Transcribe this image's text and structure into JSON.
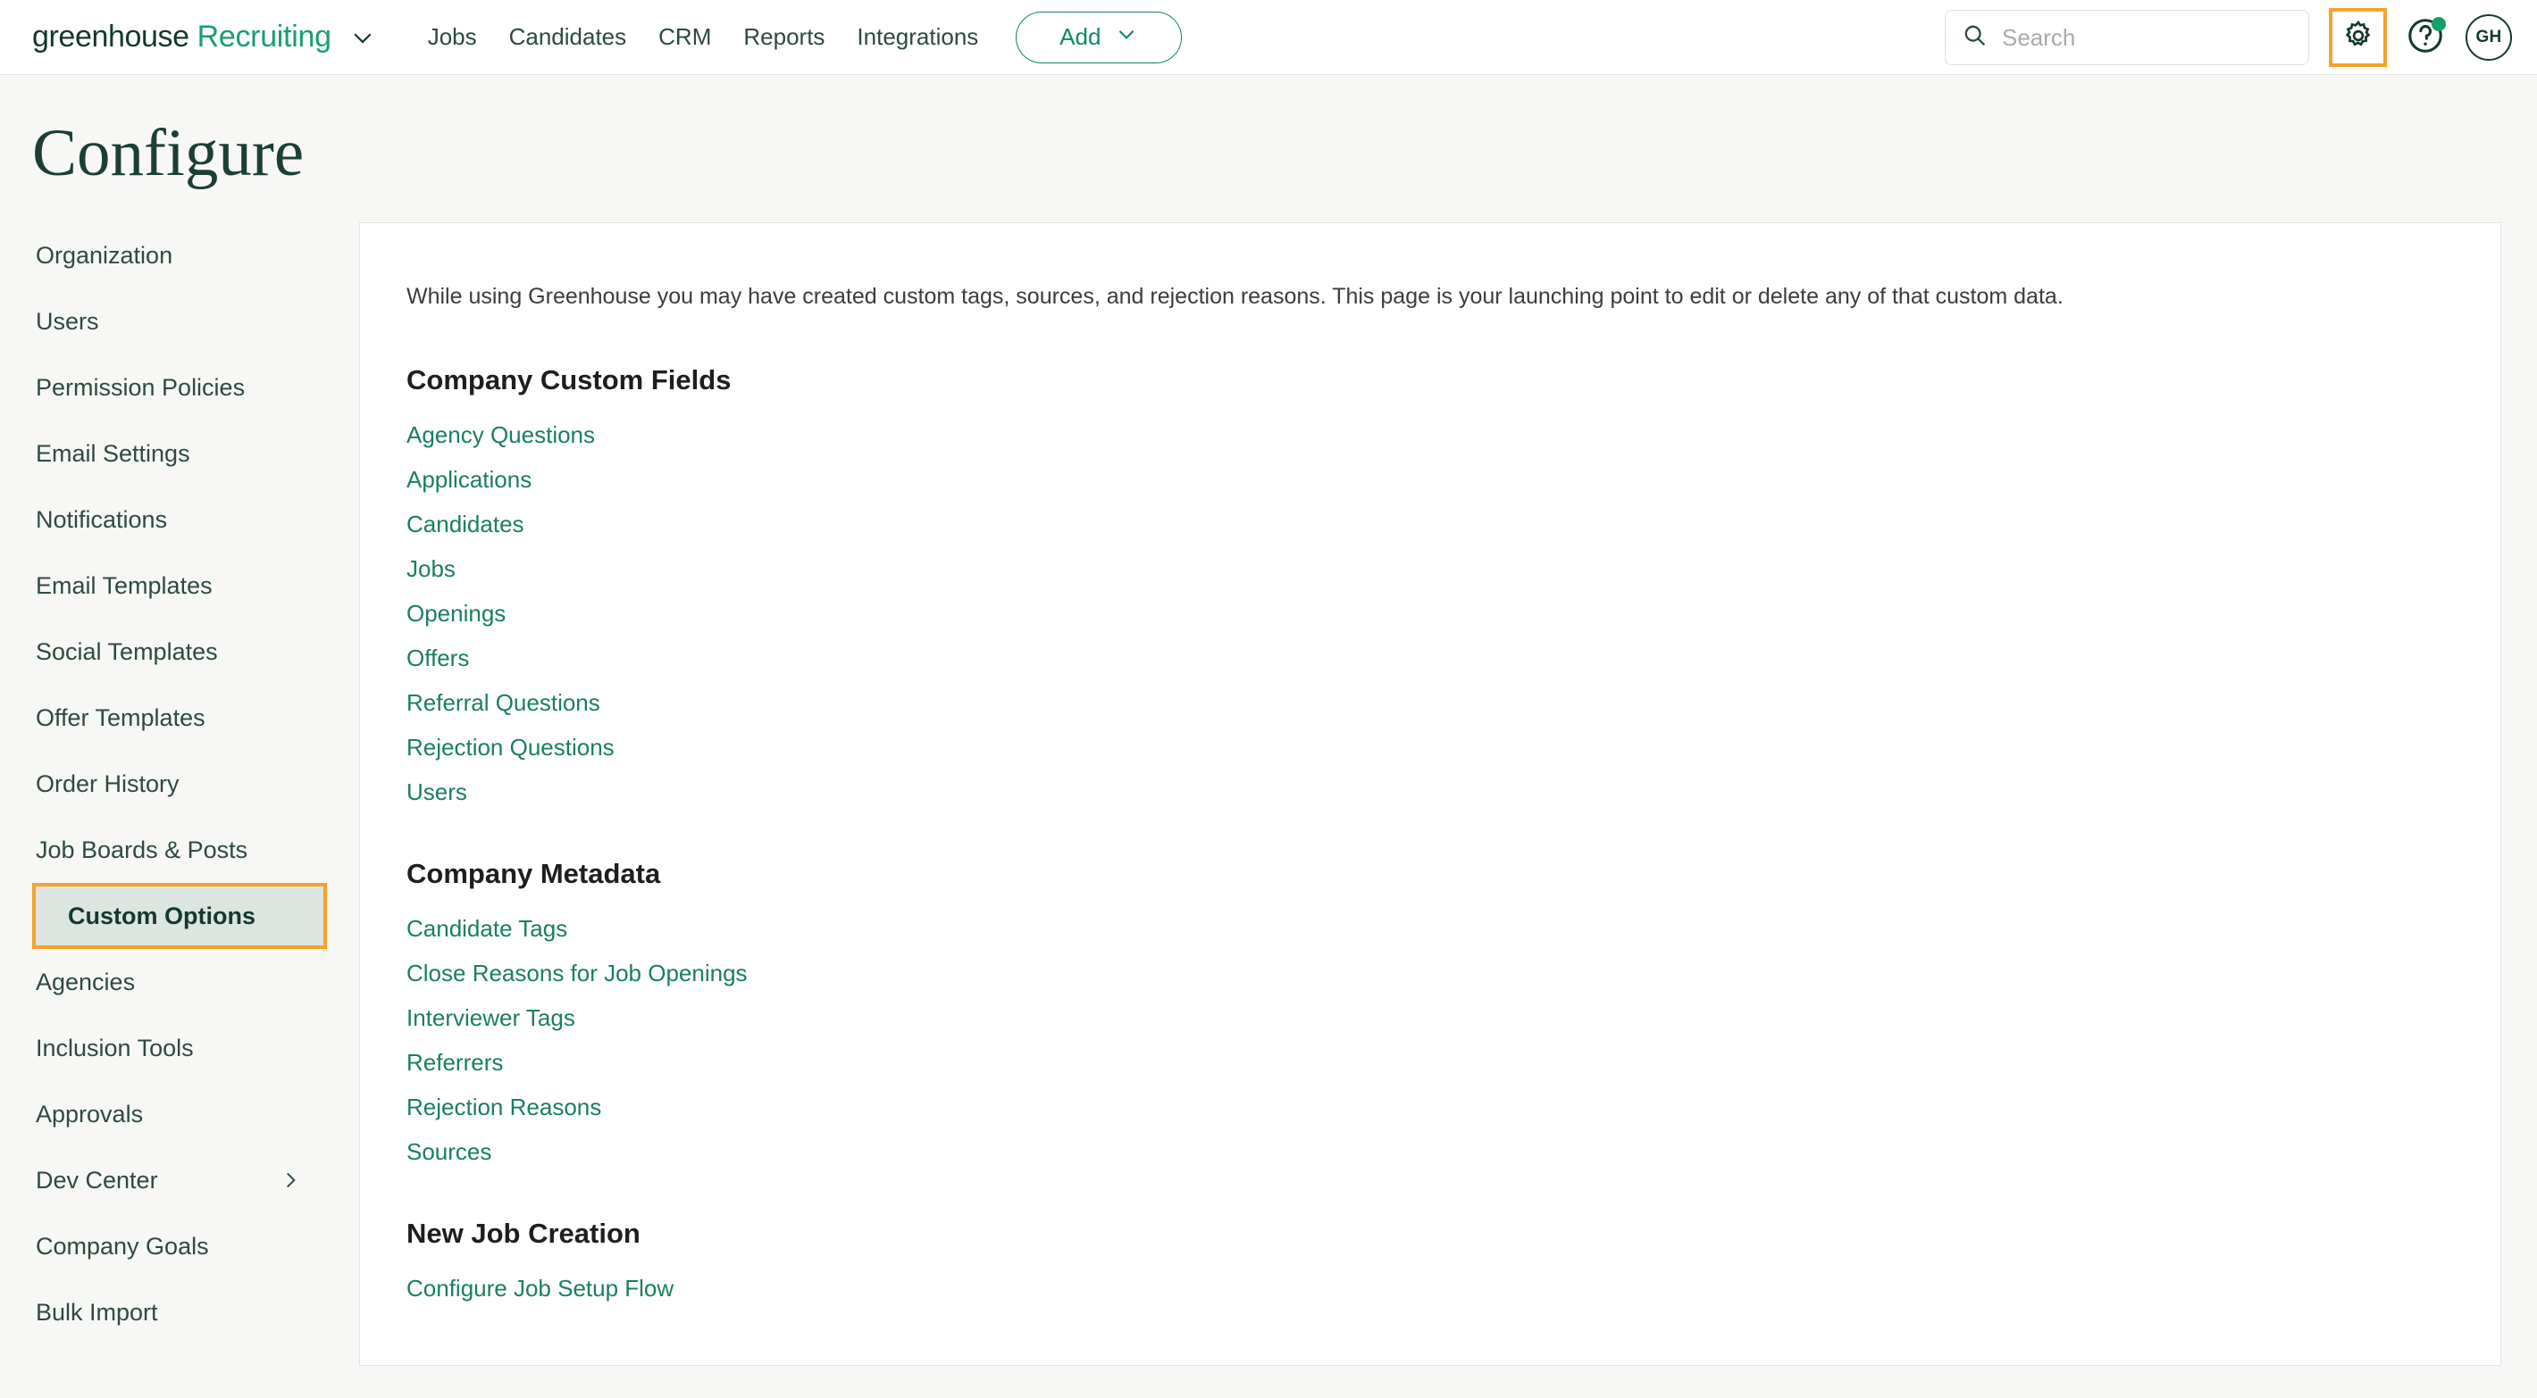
{
  "header": {
    "brand_primary": "greenhouse",
    "brand_secondary": "Recruiting",
    "brand_caret_icon": "chevron-down-icon",
    "nav_links": [
      {
        "label": "Jobs"
      },
      {
        "label": "Candidates"
      },
      {
        "label": "CRM"
      },
      {
        "label": "Reports"
      },
      {
        "label": "Integrations"
      }
    ],
    "add_button": {
      "label": "Add",
      "icon": "chevron-down-icon"
    },
    "search": {
      "placeholder": "Search",
      "value": "",
      "icon": "search-icon"
    },
    "gear": {
      "icon": "gear-icon",
      "highlight_color": "#f4a32c"
    },
    "help": {
      "icon": "question-circle-icon",
      "badge_color": "#12a06a"
    },
    "avatar": {
      "initials": "GH"
    }
  },
  "page": {
    "title": "Configure"
  },
  "sidebar": {
    "items": [
      {
        "label": "Organization",
        "active": false,
        "chevron": false
      },
      {
        "label": "Users",
        "active": false,
        "chevron": false
      },
      {
        "label": "Permission Policies",
        "active": false,
        "chevron": false
      },
      {
        "label": "Email Settings",
        "active": false,
        "chevron": false
      },
      {
        "label": "Notifications",
        "active": false,
        "chevron": false
      },
      {
        "label": "Email Templates",
        "active": false,
        "chevron": false
      },
      {
        "label": "Social Templates",
        "active": false,
        "chevron": false
      },
      {
        "label": "Offer Templates",
        "active": false,
        "chevron": false
      },
      {
        "label": "Order History",
        "active": false,
        "chevron": false
      },
      {
        "label": "Job Boards & Posts",
        "active": false,
        "chevron": false
      },
      {
        "label": "Custom Options",
        "active": true,
        "chevron": false
      },
      {
        "label": "Agencies",
        "active": false,
        "chevron": false
      },
      {
        "label": "Inclusion Tools",
        "active": false,
        "chevron": false
      },
      {
        "label": "Approvals",
        "active": false,
        "chevron": false
      },
      {
        "label": "Dev Center",
        "active": false,
        "chevron": true
      },
      {
        "label": "Company Goals",
        "active": false,
        "chevron": false
      },
      {
        "label": "Bulk Import",
        "active": false,
        "chevron": false
      }
    ]
  },
  "main": {
    "intro": "While using Greenhouse you may have created custom tags, sources, and rejection reasons. This page is your launching point to edit or delete any of that custom data.",
    "sections": [
      {
        "title": "Company Custom Fields",
        "links": [
          "Agency Questions",
          "Applications",
          "Candidates",
          "Jobs",
          "Openings",
          "Offers",
          "Referral Questions",
          "Rejection Questions",
          "Users"
        ]
      },
      {
        "title": "Company Metadata",
        "links": [
          "Candidate Tags",
          "Close Reasons for Job Openings",
          "Interviewer Tags",
          "Referrers",
          "Rejection Reasons",
          "Sources"
        ]
      },
      {
        "title": "New Job Creation",
        "links": [
          "Configure Job Setup Flow"
        ]
      }
    ]
  },
  "colors": {
    "brand_green": "#199e6f",
    "link_green": "#1a8059",
    "dark_green": "#15382e",
    "highlight_orange": "#f4a32c",
    "active_bg": "#dce5e0",
    "page_bg": "#f7f7f6"
  }
}
